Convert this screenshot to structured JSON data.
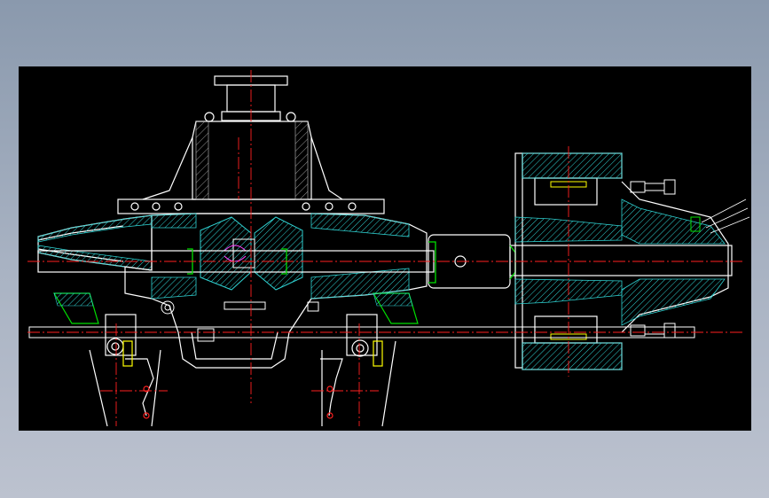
{
  "viewer": {
    "background_color": "#000000",
    "page_gradient_top": "#8a99ad",
    "page_gradient_bottom": "#bcc2cf"
  },
  "drawing": {
    "layer_colors": {
      "outline": "#ffffff",
      "centerline": "#ff2020",
      "hatch": "#2fd1d1",
      "section": "#00c8c8",
      "part": "#00e000",
      "highlight": "#ffff00",
      "accent": "#ff40ff"
    },
    "icons": [
      "cad-drawing-icon"
    ]
  }
}
